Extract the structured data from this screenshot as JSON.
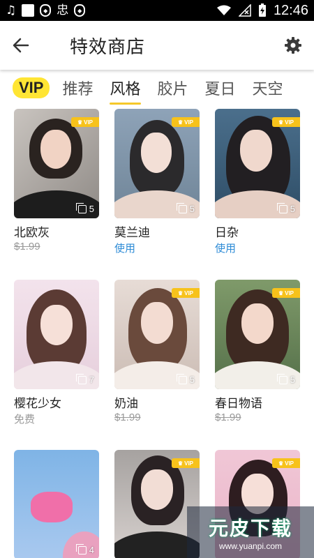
{
  "status_bar": {
    "time": "12:46",
    "left_icons": [
      "music-note-icon",
      "square-icon",
      "shield-icon",
      "app-icon",
      "shield-icon"
    ],
    "right_icons": [
      "wifi-icon",
      "no-signal-icon",
      "battery-charging-icon"
    ]
  },
  "header": {
    "title": "特效商店",
    "back_icon": "back-arrow-icon",
    "settings_icon": "gear-icon"
  },
  "tabs": [
    {
      "label": "VIP"
    },
    {
      "label": "推荐"
    },
    {
      "label": "风格",
      "active": true
    },
    {
      "label": "胶片"
    },
    {
      "label": "夏日"
    },
    {
      "label": "天空"
    }
  ],
  "cards": [
    {
      "name": "北欧灰",
      "price": "$1.99",
      "price_style": "strike",
      "count": "5",
      "vip": true
    },
    {
      "name": "莫兰迪",
      "price": "使用",
      "price_style": "use",
      "count": "5",
      "vip": true
    },
    {
      "name": "日杂",
      "price": "使用",
      "price_style": "use",
      "count": "5",
      "vip": true
    },
    {
      "name": "樱花少女",
      "price": "免费",
      "price_style": "free",
      "count": "7",
      "vip": false
    },
    {
      "name": "奶油",
      "price": "$1.99",
      "price_style": "strike",
      "count": "5",
      "vip": true
    },
    {
      "name": "春日物语",
      "price": "$1.99",
      "price_style": "strike",
      "count": "5",
      "vip": true
    },
    {
      "name": "",
      "price": "",
      "count": "4",
      "vip": false
    },
    {
      "name": "",
      "price": "",
      "count": "",
      "vip": true
    },
    {
      "name": "",
      "price": "",
      "count": "",
      "vip": true
    }
  ],
  "vip_badge_label": "VIP",
  "watermark": {
    "main": "元皮下载",
    "url": "www.yuanpi.com"
  },
  "colors": {
    "accent": "#f5c82a",
    "vip_tab": "#ffe534",
    "use_link": "#2d8bd6"
  }
}
